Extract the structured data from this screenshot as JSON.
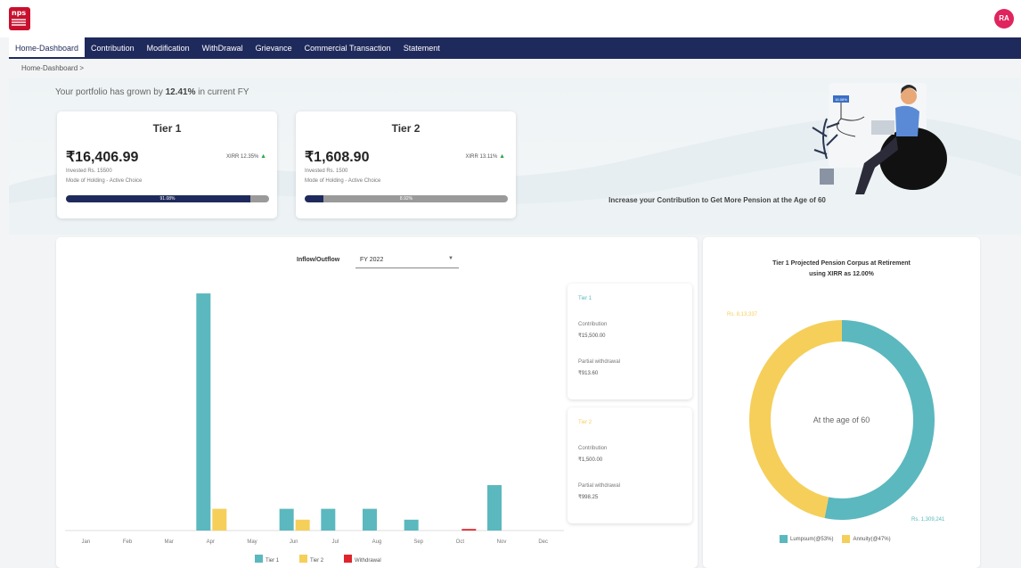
{
  "header": {
    "logo_text": "nps",
    "avatar_initials": "RA"
  },
  "nav": {
    "items": [
      "Home-Dashboard",
      "Contribution",
      "Modification",
      "WithDrawal",
      "Grievance",
      "Commercial Transaction",
      "Statement"
    ],
    "active_index": 0
  },
  "breadcrumb": "Home-Dashboard >",
  "growth": {
    "prefix": "Your portfolio has grown by ",
    "value": "12.41%",
    "suffix": " in current FY"
  },
  "tiers": [
    {
      "title": "Tier 1",
      "amount": "₹16,406.99",
      "xirr": "XIRR 12.35%",
      "invested": "Invested Rs. 15500",
      "mode": "Mode of Holding - Active Choice",
      "progress_label": "91.08%",
      "progress": 0.91
    },
    {
      "title": "Tier 2",
      "amount": "₹1,608.90",
      "xirr": "XIRR 13.11%",
      "invested": "Invested Rs. 1500",
      "mode": "Mode of Holding - Active Choice",
      "progress_label": "8.92%",
      "progress": 0.09
    }
  ],
  "promo": {
    "text": "Increase your Contribution to Get More Pension at the Age of 60",
    "screen_text": "16.08%"
  },
  "inflow": {
    "label": "Inflow/Outflow",
    "selected_fy": "FY 2022"
  },
  "info_cards": [
    {
      "title": "Tier 1",
      "contribution_label": "Contribution",
      "contribution_value": "₹15,500.00",
      "withdrawal_label": "Partial withdrawal",
      "withdrawal_value": "₹913.60"
    },
    {
      "title": "Tier 2",
      "contribution_label": "Contribution",
      "contribution_value": "₹1,500.00",
      "withdrawal_label": "Partial withdrawal",
      "withdrawal_value": "₹998.25"
    }
  ],
  "projection": {
    "title_line1": "Tier 1 Projected Pension Corpus at Retirement",
    "title_line2": "using XIRR as 12.00%",
    "center_text": "At the age of 60",
    "annuity_value": "Rs. 8,13,337",
    "lumpsum_value": "Rs. 1,309,241",
    "legend_lumpsum": "Lumpsum(@53%)",
    "legend_annuity": "Annuity(@47%)"
  },
  "colors": {
    "navy": "#1f2a5c",
    "tier1": "#5bb8be",
    "tier2": "#f5cf5a",
    "withdrawal": "#e0242c",
    "brand_red": "#c8102e",
    "up_green": "#2ea84a"
  },
  "chart_data": [
    {
      "type": "bar",
      "categories": [
        "Jan",
        "Feb",
        "Mar",
        "Apr",
        "May",
        "Jun",
        "Jul",
        "Aug",
        "Sep",
        "Oct",
        "Nov",
        "Dec"
      ],
      "series": [
        {
          "name": "Tier 1",
          "values": [
            0,
            0,
            0,
            12000,
            0,
            1100,
            1100,
            1100,
            550,
            0,
            2300,
            0
          ]
        },
        {
          "name": "Tier 2",
          "values": [
            0,
            0,
            0,
            1100,
            0,
            550,
            0,
            0,
            0,
            0,
            0,
            0
          ]
        },
        {
          "name": "Withdrawal",
          "values": [
            0,
            0,
            0,
            0,
            0,
            0,
            0,
            0,
            0,
            80,
            0,
            0
          ]
        }
      ],
      "legend": [
        "Tier 1",
        "Tier 2",
        "Withdrawal"
      ],
      "title": "",
      "xlabel": "",
      "ylabel": "",
      "ylim": [
        0,
        12500
      ],
      "grid": false,
      "legend_placement": "bottom"
    },
    {
      "type": "pie",
      "donut": true,
      "labels": [
        "Lumpsum(@53%)",
        "Annuity(@47%)"
      ],
      "values": [
        53,
        47
      ],
      "title": "Tier 1 Projected Pension Corpus at Retirement"
    }
  ]
}
